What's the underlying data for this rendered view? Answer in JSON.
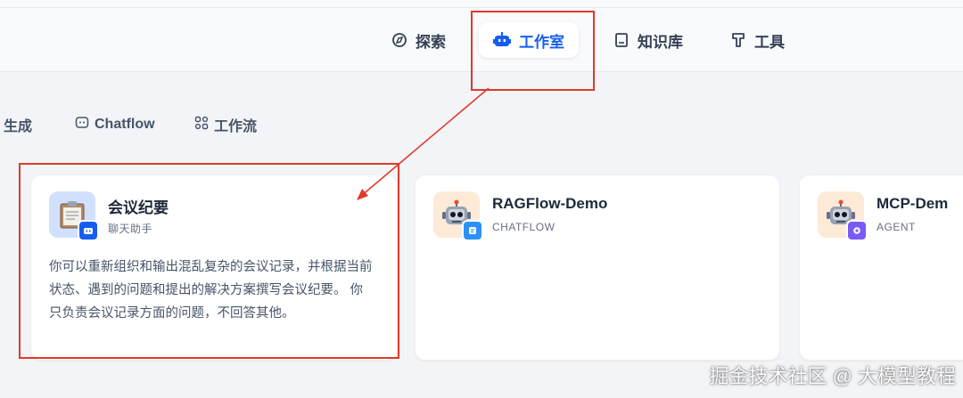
{
  "top_nav": {
    "items": [
      {
        "label": "探索",
        "icon": "explore-icon"
      },
      {
        "label": "工作室",
        "icon": "robot-icon",
        "active": true
      },
      {
        "label": "知识库",
        "icon": "book-icon"
      },
      {
        "label": "工具",
        "icon": "hammer-icon"
      }
    ],
    "active_color": "#155eef"
  },
  "filter_tabs": [
    {
      "label": "生成",
      "icon": ""
    },
    {
      "label": "Chatflow",
      "icon": "chat-icon"
    },
    {
      "label": "工作流",
      "icon": "workflow-icon"
    }
  ],
  "cards": [
    {
      "title": "会议纪要",
      "type": "聊天助手",
      "icon": "clipboard-icon",
      "badge_icon": "robot-badge-icon",
      "badge_color": "#155eef",
      "description": "你可以重新组织和输出混乱复杂的会议记录，并根据当前状态、遇到的问题和提出的解决方案撰写会议纪要。 你只负责会议记录方面的问题，不回答其他。"
    },
    {
      "title": "RAGFlow-Demo",
      "type": "CHATFLOW",
      "icon": "robot-face-icon",
      "badge_icon": "chat-badge-icon",
      "badge_color": "#2e90fa"
    },
    {
      "title": "MCP-Dem",
      "type": "AGENT",
      "icon": "robot-face-icon",
      "badge_icon": "agent-badge-icon",
      "badge_color": "#7a5af8"
    }
  ],
  "annotation": {
    "color": "#e0392b"
  },
  "watermark": "掘金技术社区 @ 大模型教程"
}
